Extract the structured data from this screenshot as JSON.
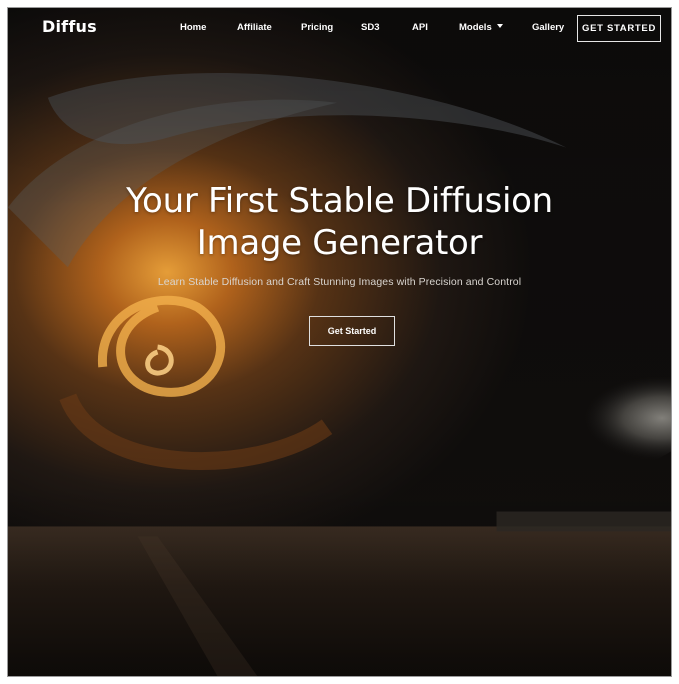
{
  "brand": {
    "name": "Diffus"
  },
  "nav": {
    "items": [
      {
        "label": "Home"
      },
      {
        "label": "Affiliate"
      },
      {
        "label": "Pricing"
      },
      {
        "label": "SD3"
      },
      {
        "label": "API"
      },
      {
        "label": "Models",
        "has_dropdown": true
      },
      {
        "label": "Gallery"
      }
    ],
    "cta_label": "GET STARTED"
  },
  "hero": {
    "title_line1": "Your First Stable Diffusion",
    "title_line2": "Image Generator",
    "subtitle": "Learn Stable Diffusion and Craft Stunning Images with Precision and Control",
    "button_label": "Get Started"
  },
  "colors": {
    "text": "#ffffff",
    "background_dark": "#0c0b0a",
    "accent_orange": "#d08a2a"
  },
  "icons": {
    "models_dropdown": "caret-down-icon"
  }
}
